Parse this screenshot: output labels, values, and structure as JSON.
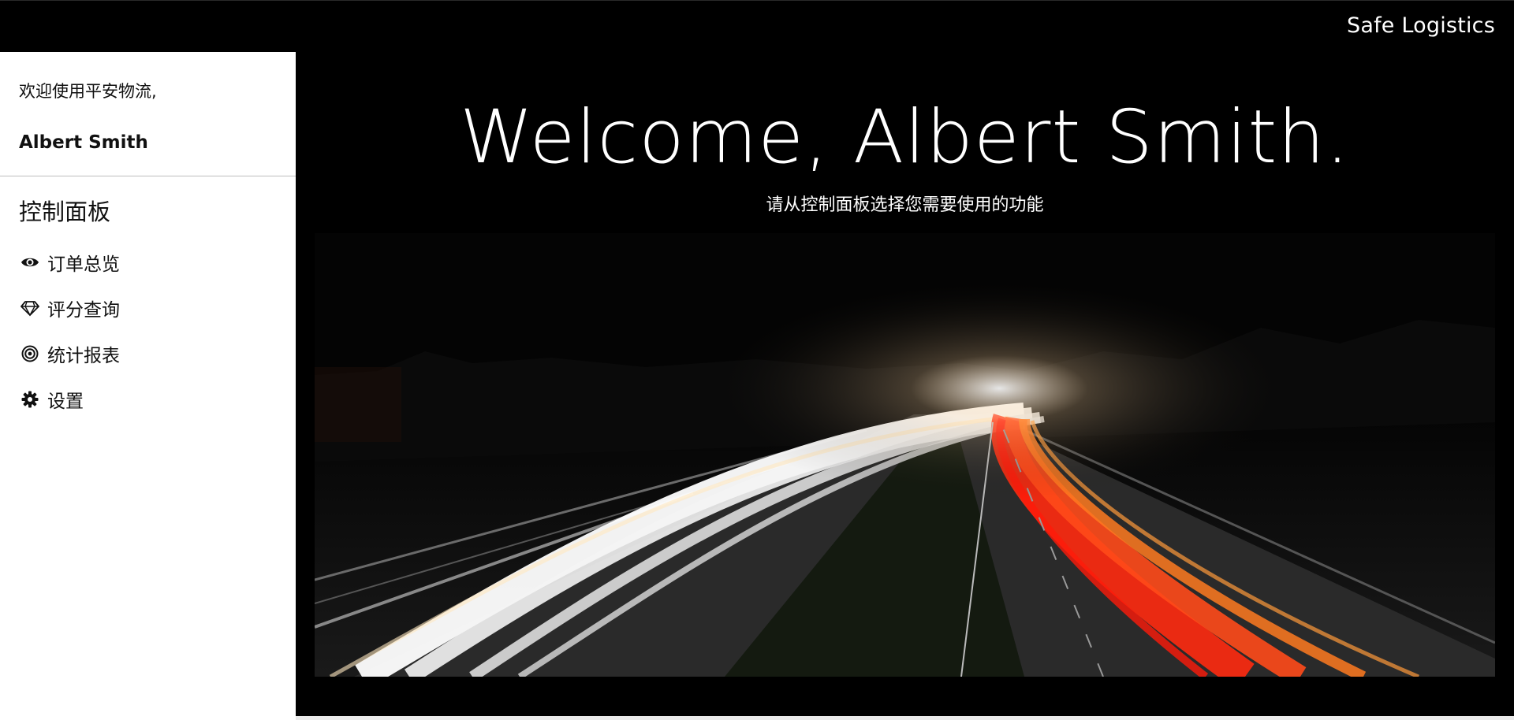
{
  "header": {
    "brand": "Safe Logistics"
  },
  "sidebar": {
    "greeting": "欢迎使用平安物流,",
    "username": "Albert Smith",
    "nav_title": "控制面板",
    "items": [
      {
        "label": "订单总览",
        "icon": "eye-icon"
      },
      {
        "label": "评分查询",
        "icon": "diamond-icon"
      },
      {
        "label": "统计报表",
        "icon": "target-icon"
      },
      {
        "label": "设置",
        "icon": "gear-icon"
      }
    ]
  },
  "main": {
    "title": "Welcome, Albert Smith.",
    "subtitle": "请从控制面板选择您需要使用的功能",
    "hero_image": "night-highway-light-trails"
  },
  "colors": {
    "background": "#000000",
    "sidebar": "#ffffff",
    "text_light": "#ffffff",
    "text_dark": "#111111",
    "trail_white": "#ffffff",
    "trail_red": "#ff3b1a"
  }
}
